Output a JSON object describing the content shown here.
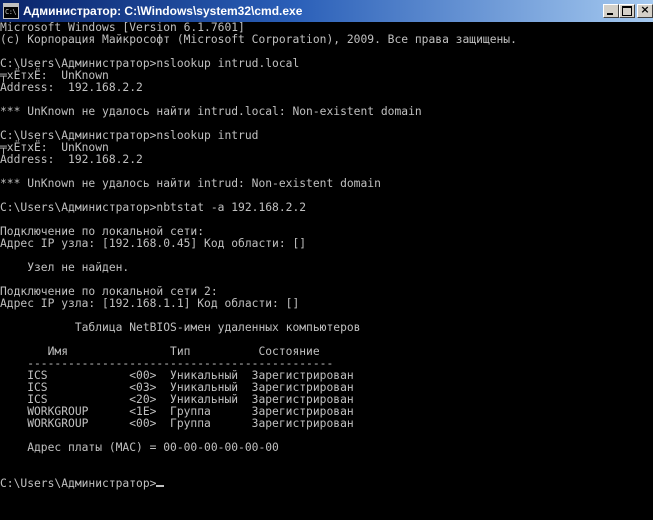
{
  "window": {
    "title": "Администратор: C:\\Windows\\system32\\cmd.exe",
    "icon_name": "cmd-icon",
    "icon_text": "C:\\",
    "close_glyph": "×"
  },
  "console": {
    "lines": [
      "Microsoft Windows [Version 6.1.7601]",
      "(c) Корпорация Майкрософт (Microsoft Corporation), 2009. Все права защищены.",
      "",
      "C:\\Users\\Администратор>nslookup intrud.local",
      "╤хЁтхЁ:  UnKnown",
      "Address:  192.168.2.2",
      "",
      "*** UnKnown не удалось найти intrud.local: Non-existent domain",
      "",
      "C:\\Users\\Администратор>nslookup intrud",
      "╤хЁтхЁ:  UnKnown",
      "Address:  192.168.2.2",
      "",
      "*** UnKnown не удалось найти intrud: Non-existent domain",
      "",
      "C:\\Users\\Администратор>nbtstat -a 192.168.2.2",
      "",
      "Подключение по локальной сети:",
      "Адрес IP узла: [192.168.0.45] Код области: []",
      "",
      "    Узел не найден.",
      "",
      "Подключение по локальной сети 2:",
      "Адрес IP узла: [192.168.1.1] Код области: []",
      "",
      "           Таблица NetBIOS-имен удаленных компьютеров",
      "",
      "       Имя               Тип          Состояние",
      "    ---------------------------------------------",
      "    ICS            <00>  Уникальный  Зарегистрирован",
      "    ICS            <03>  Уникальный  Зарегистрирован",
      "    ICS            <20>  Уникальный  Зарегистрирован",
      "    WORKGROUP      <1E>  Группа      Зарегистрирован",
      "    WORKGROUP      <00>  Группа      Зарегистрирован",
      "",
      "    Адрес платы (MAC) = 00-00-00-00-00-00",
      "",
      "",
      "C:\\Users\\Администратор>"
    ]
  }
}
